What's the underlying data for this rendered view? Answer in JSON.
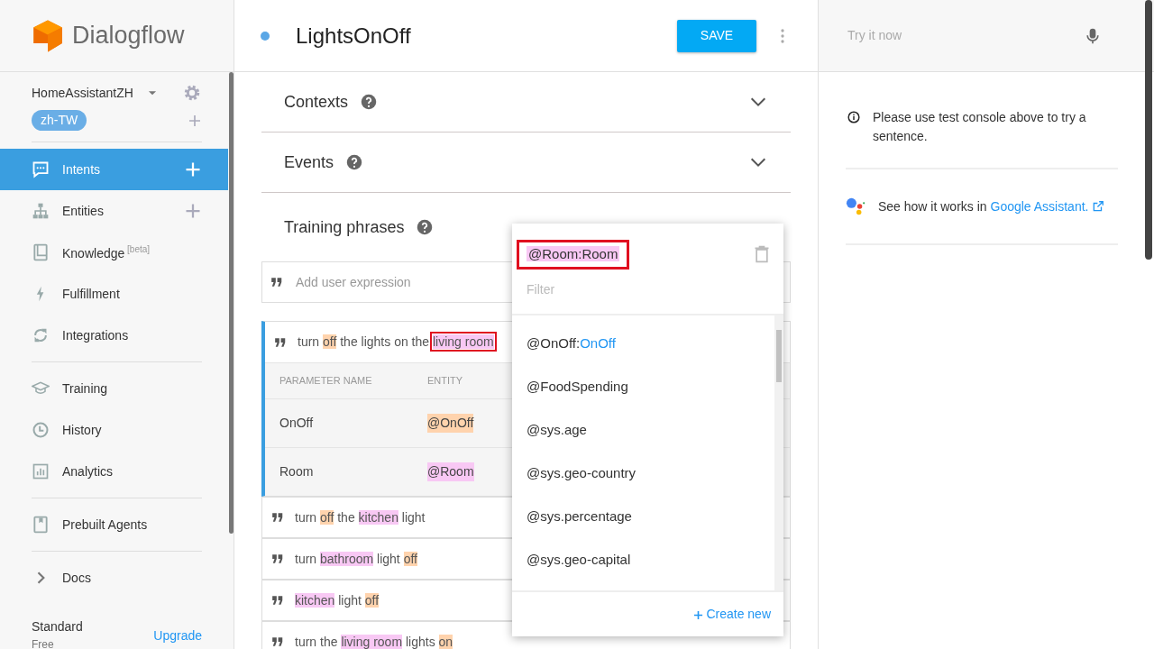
{
  "brand": {
    "name": "Dialogflow"
  },
  "agent": {
    "name": "HomeAssistantZH",
    "language": "zh-TW"
  },
  "sidebar": {
    "items": [
      {
        "label": "Intents",
        "selected": true,
        "add": true
      },
      {
        "label": "Entities",
        "selected": false,
        "add": true
      },
      {
        "label": "Knowledge",
        "sup": "[beta]",
        "selected": false,
        "add": false
      },
      {
        "label": "Fulfillment",
        "selected": false,
        "add": false
      },
      {
        "label": "Integrations",
        "selected": false,
        "add": false
      },
      {
        "label": "Training",
        "selected": false,
        "add": false
      },
      {
        "label": "History",
        "selected": false,
        "add": false
      },
      {
        "label": "Analytics",
        "selected": false,
        "add": false
      },
      {
        "label": "Prebuilt Agents",
        "selected": false,
        "add": false
      },
      {
        "label": "Docs",
        "selected": false,
        "add": false
      }
    ],
    "plan": {
      "name": "Standard",
      "tier": "Free",
      "link": "Upgrade"
    }
  },
  "intent": {
    "title": "LightsOnOff",
    "save": "SAVE"
  },
  "sections": [
    {
      "title": "Contexts",
      "expanded": false
    },
    {
      "title": "Events",
      "expanded": false
    }
  ],
  "training": {
    "title": "Training phrases",
    "placeholder": "Add user expression",
    "phrases": [
      {
        "selected": true,
        "segments": [
          {
            "text": "turn "
          },
          {
            "text": "off",
            "color": "#ffd3ad"
          },
          {
            "text": " the lights on the "
          },
          {
            "text": "living room",
            "color": "#f8c8f4",
            "boxed": true
          }
        ],
        "parameter_header": [
          "PARAMETER NAME",
          "ENTITY"
        ],
        "parameters": [
          {
            "name": "OnOff",
            "entity": "@OnOff",
            "color": "#ffd3ad"
          },
          {
            "name": "Room",
            "entity": "@Room",
            "color": "#f8c8f4"
          }
        ]
      },
      {
        "selected": false,
        "segments": [
          {
            "text": "turn "
          },
          {
            "text": "off",
            "color": "#ffd3ad"
          },
          {
            "text": " the "
          },
          {
            "text": "kitchen",
            "color": "#f8c8f4"
          },
          {
            "text": " light"
          }
        ]
      },
      {
        "selected": false,
        "segments": [
          {
            "text": "turn "
          },
          {
            "text": "bathroom",
            "color": "#f8c8f4"
          },
          {
            "text": " light "
          },
          {
            "text": "off",
            "color": "#ffd3ad"
          }
        ]
      },
      {
        "selected": false,
        "segments": [
          {
            "text": "kitchen",
            "color": "#f8c8f4"
          },
          {
            "text": " light "
          },
          {
            "text": "off",
            "color": "#ffd3ad"
          }
        ]
      },
      {
        "selected": false,
        "segments": [
          {
            "text": "turn the "
          },
          {
            "text": "living room",
            "color": "#f8c8f4"
          },
          {
            "text": " lights "
          },
          {
            "text": "on",
            "color": "#ffd3ad"
          }
        ]
      }
    ]
  },
  "entity_popup": {
    "current": "@Room:Room",
    "boxed": true,
    "filter_placeholder": "Filter",
    "options": [
      {
        "entity": "@OnOff:",
        "param": "OnOff"
      },
      {
        "entity": "@FoodSpending"
      },
      {
        "entity": "@sys.age"
      },
      {
        "entity": "@sys.geo-country"
      },
      {
        "entity": "@sys.percentage"
      },
      {
        "entity": "@sys.geo-capital"
      }
    ],
    "create": "Create new"
  },
  "console": {
    "placeholder": "Try it now",
    "info": "Please use test console above to try a sentence.",
    "assistant_text": "See how it works in ",
    "assistant_link": "Google Assistant."
  }
}
